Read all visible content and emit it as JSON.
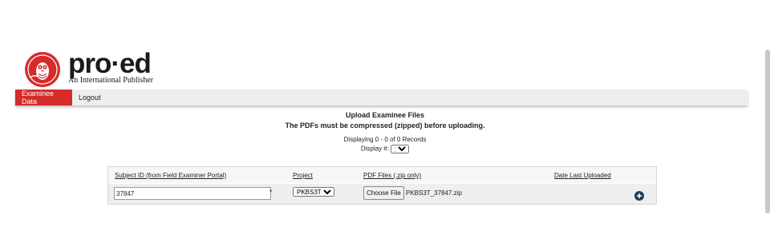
{
  "logo": {
    "word": "pro·ed",
    "tagline": "An International Publisher",
    "brand_color": "#d52b2b"
  },
  "nav": {
    "items": [
      {
        "label": "Examinee Data",
        "active": true
      },
      {
        "label": "Logout",
        "active": false
      }
    ]
  },
  "main": {
    "title": "Upload Examinee Files",
    "subtitle": "The PDFs must be compressed (zipped) before uploading.",
    "records_text": "Displaying 0 - 0 of 0 Records",
    "display_label": "Display #:",
    "display_value": "20"
  },
  "table": {
    "headers": {
      "subject": "Subject ID (from Field Examiner Portal)",
      "project": "Project",
      "pdf_files": "PDF Files (.zip only)",
      "date": "Date Last Uploaded"
    },
    "row": {
      "subject_id": "37847",
      "required_mark": "*",
      "project": "PKBS3T",
      "choose_file_label": "Choose File",
      "file_name": "PKBS3T_37847.zip",
      "add_icon": "plus-circle-icon"
    }
  }
}
